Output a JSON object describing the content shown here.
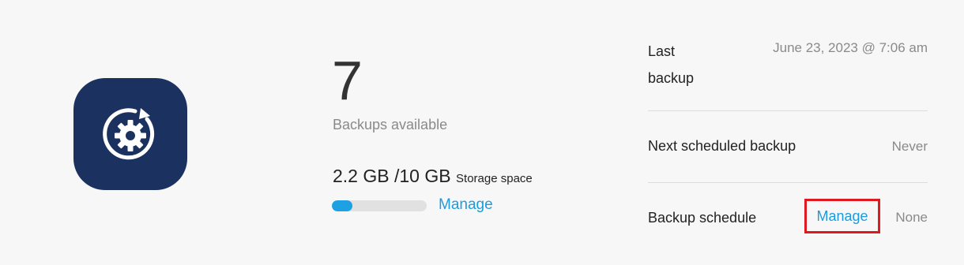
{
  "app": {
    "icon": "backup-sync-icon",
    "icon_color": "#1b3260"
  },
  "backups": {
    "count": "7",
    "label": "Backups available"
  },
  "storage": {
    "used": "2.2 GB /10 GB",
    "label": "Storage space",
    "used_fraction": 0.22,
    "manage_label": "Manage"
  },
  "info": {
    "last_backup_label": "Last backup",
    "last_backup_value": "June 23, 2023 @ 7:06 am",
    "next_backup_label": "Next scheduled backup",
    "next_backup_value": "Never",
    "schedule_label": "Backup schedule",
    "schedule_manage_label": "Manage",
    "schedule_value": "None"
  },
  "colors": {
    "accent": "#1d9bdc",
    "progress_fill": "#1da1e2",
    "highlight_border": "#e0191f"
  }
}
